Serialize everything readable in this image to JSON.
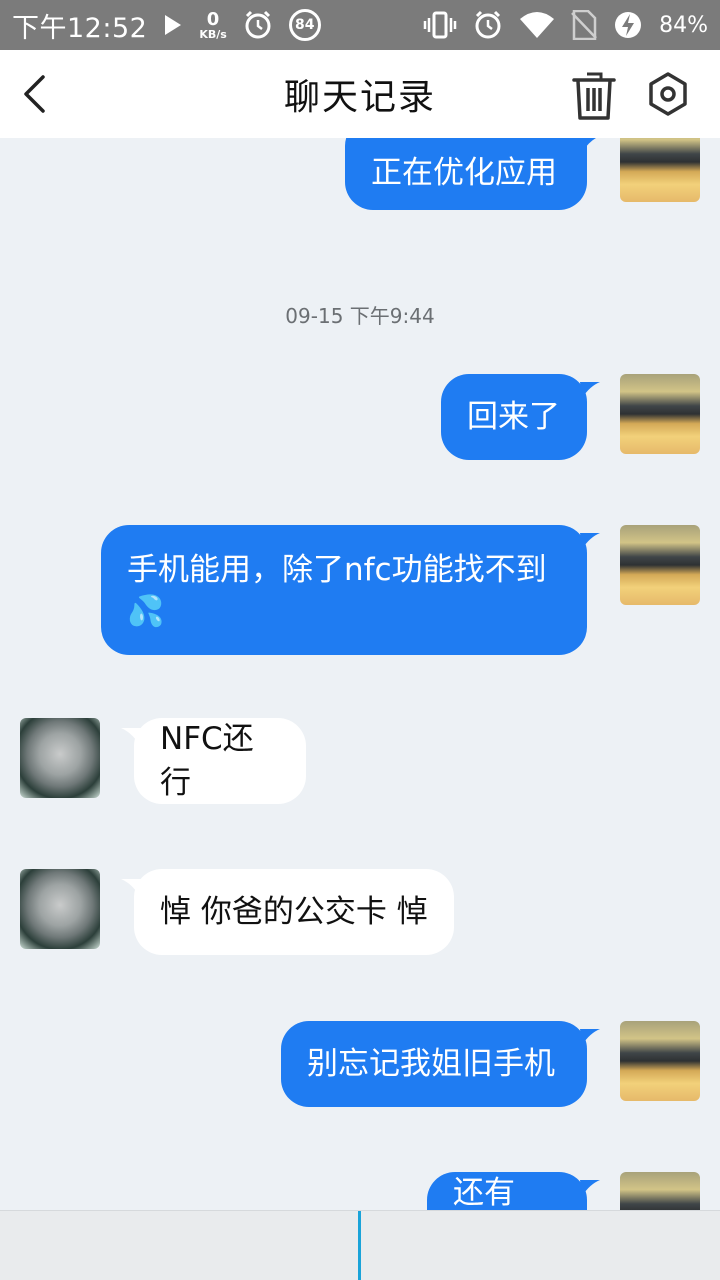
{
  "status_bar": {
    "time": "下午12:52",
    "speed_value": "0",
    "speed_unit": "KB/s",
    "badge": "84",
    "battery": "84%"
  },
  "header": {
    "title": "聊天记录",
    "icons": [
      "back-arrow-icon",
      "trash-icon",
      "settings-icon"
    ]
  },
  "messages": [
    {
      "side": "me",
      "text": "正在优化应用"
    },
    {
      "type": "timestamp",
      "text": "09-15 下午9:44"
    },
    {
      "side": "me",
      "text": "回来了"
    },
    {
      "side": "me",
      "text": "手机能用，除了nfc功能找不到",
      "emoji": "💦"
    },
    {
      "side": "them",
      "text": "NFC还行"
    },
    {
      "side": "them",
      "text": "悼 你爸的公交卡 悼"
    },
    {
      "side": "me",
      "text": "别忘记我姐旧手机"
    },
    {
      "side": "me",
      "text": "还有nfc"
    }
  ],
  "colors": {
    "accent": "#1f7cf2",
    "background": "#edf1f5",
    "statusbar": "#7b7b7b"
  }
}
